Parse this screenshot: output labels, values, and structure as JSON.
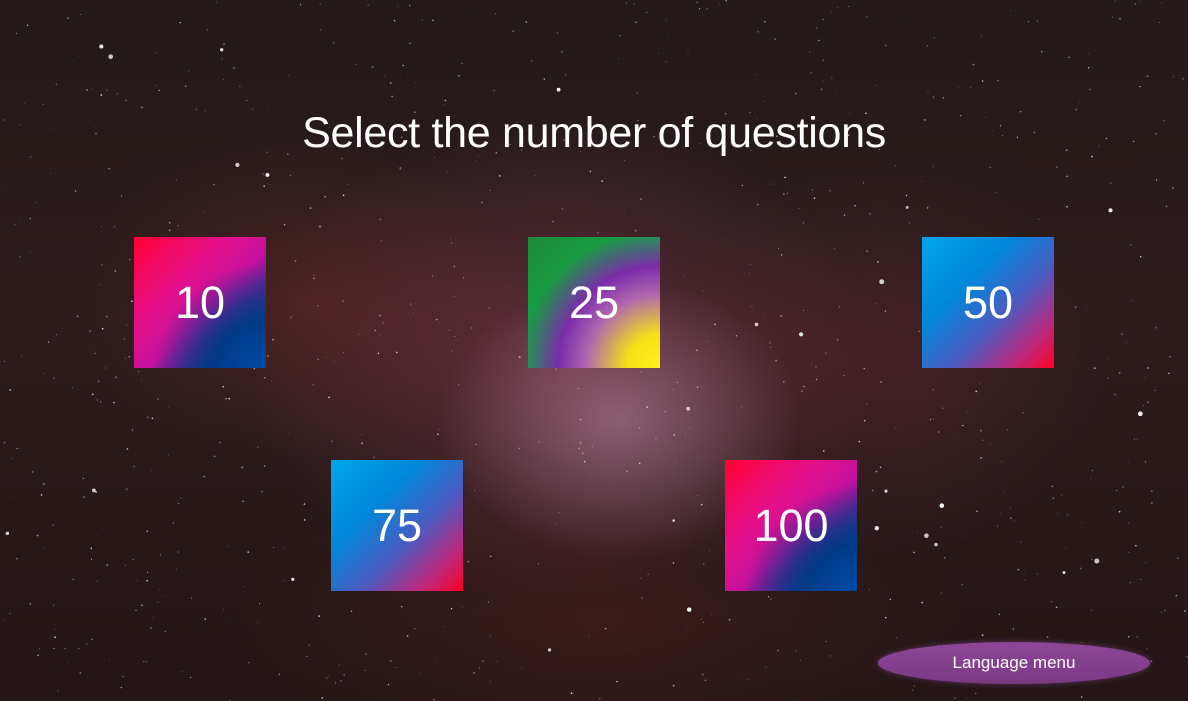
{
  "title": "Select the number of questions",
  "options": [
    {
      "label": "10"
    },
    {
      "label": "25"
    },
    {
      "label": "50"
    },
    {
      "label": "75"
    },
    {
      "label": "100"
    }
  ],
  "language_button": {
    "label": "Language menu",
    "color": "#7f3f8a"
  },
  "tile_gradients": {
    "pink_blue": [
      "#ff0033",
      "#e4108a",
      "#003c8c"
    ],
    "green_purple_yellow": [
      "#10a845",
      "#7a2ca8",
      "#fff21a"
    ],
    "blue_red": [
      "#00a6ea",
      "#4a5cc2",
      "#ff0022"
    ]
  }
}
